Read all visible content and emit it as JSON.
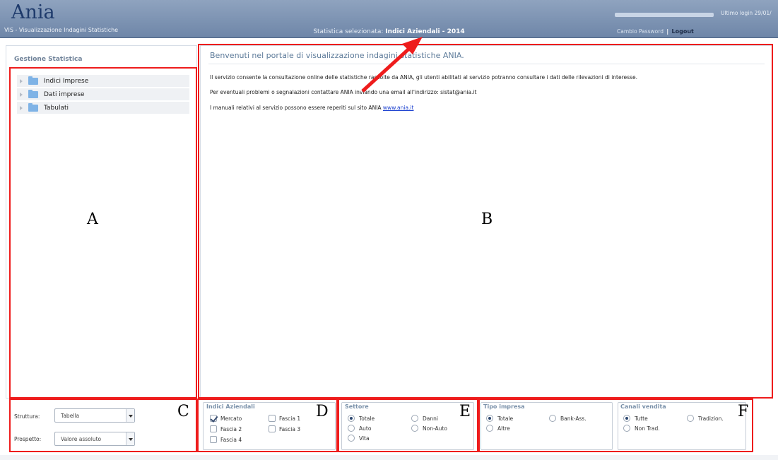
{
  "header": {
    "logo": "Ania",
    "app_subtitle": "VIS - Visualizzazione Indagini Statistiche",
    "stat_prefix": "Statistica selezionata:",
    "stat_value": "Indici Aziendali - 2014",
    "last_login": "Ultimo login 29/01/",
    "change_password": "Cambio Password",
    "separator": "|",
    "logout": "Logout"
  },
  "sidebar": {
    "title": "Gestione Statistica",
    "items": [
      {
        "label": "Indici Imprese"
      },
      {
        "label": "Dati imprese"
      },
      {
        "label": "Tabulati"
      }
    ]
  },
  "main": {
    "welcome_title": "Benvenuti nel portale di visualizzazione indagini statistiche ANIA.",
    "p1": "Il servizio consente la consultazione online delle statistiche raccolte da ANIA, gli utenti abilitati al servizio potranno consultare i dati delle rilevazioni di interesse.",
    "p2": "Per eventuali problemi o segnalazioni contattare ANIA inviando una email all'indirizzo: sistat@ania.it",
    "p3_prefix": "I manuali relativi al servizio possono essere reperiti sul sito ANIA",
    "p3_link": "www.ania.it"
  },
  "controls": {
    "struttura_label": "Struttura:",
    "struttura_value": "Tabella",
    "prospetto_label": "Prospetto:",
    "prospetto_value": "Valore assoluto",
    "indici": {
      "title": "Indici Aziendali",
      "options": [
        {
          "label": "Mercato",
          "checked": true
        },
        {
          "label": "Fascia 1",
          "checked": false
        },
        {
          "label": "Fascia 2",
          "checked": false
        },
        {
          "label": "Fascia 3",
          "checked": false
        },
        {
          "label": "Fascia 4",
          "checked": false
        }
      ]
    },
    "settore": {
      "title": "Settore",
      "options": [
        {
          "label": "Totale",
          "selected": true
        },
        {
          "label": "Danni",
          "selected": false
        },
        {
          "label": "Auto",
          "selected": false
        },
        {
          "label": "Non-Auto",
          "selected": false
        },
        {
          "label": "Vita",
          "selected": false
        }
      ]
    },
    "tipo_impresa": {
      "title": "Tipo impresa",
      "options": [
        {
          "label": "Totale",
          "selected": true
        },
        {
          "label": "Bank-Ass.",
          "selected": false
        },
        {
          "label": "Altre",
          "selected": false
        }
      ]
    },
    "canali": {
      "title": "Canali vendita",
      "options": [
        {
          "label": "Tutte",
          "selected": true
        },
        {
          "label": "Tradizion.",
          "selected": false
        },
        {
          "label": "Non Trad.",
          "selected": false
        }
      ]
    }
  },
  "annotations": {
    "a": "A",
    "b": "B",
    "c": "C",
    "d": "D",
    "e": "E",
    "f": "F",
    "color": "#ee1c1c"
  }
}
